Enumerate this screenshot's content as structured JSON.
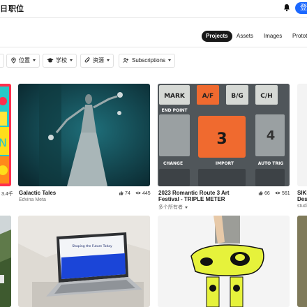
{
  "header": {
    "brand_fragment": "日",
    "jobs_label": "职位",
    "signin_label": "登"
  },
  "tabs": [
    {
      "label": "Projects",
      "active": true
    },
    {
      "label": "Assets",
      "active": false
    },
    {
      "label": "Images",
      "active": false
    },
    {
      "label": "Prototy",
      "active": false
    }
  ],
  "filters": [
    {
      "label": "位置",
      "icon": "location-pin-icon"
    },
    {
      "label": "学校",
      "icon": "graduation-cap-icon"
    },
    {
      "label": "资源",
      "icon": "paperclip-icon"
    },
    {
      "label": "Subscriptions",
      "icon": "users-icon"
    }
  ],
  "cards": [
    {
      "title": "",
      "owner": "",
      "appreciations": "",
      "views": "3.4千"
    },
    {
      "title": "Galactic Tales",
      "owner": "Edvina Meta",
      "appreciations": "74",
      "views": "445"
    },
    {
      "title": "2023 Romantic Route 3 Art Festival - TRIPLE METER",
      "owner": "多个所有者",
      "appreciations": "66",
      "views": "561"
    },
    {
      "title": "SIKE Desi",
      "owner": "studi"
    }
  ],
  "keyboard_art": {
    "row1": [
      "MARK",
      "A/F",
      "B/G",
      "C/H"
    ],
    "row2_left_label": "END POINT",
    "center_key": "3",
    "row3": [
      "CHANGE",
      "IMPORT",
      "AUTO TRIG"
    ]
  },
  "laptop_screen_text": "Shaping the Future Today",
  "colors": {
    "brand_blue": "#1b68ff",
    "keyboard_orange": "#f06a2f",
    "keyboard_gray": "#5b6064",
    "bag_yellow": "#e6f23b"
  }
}
